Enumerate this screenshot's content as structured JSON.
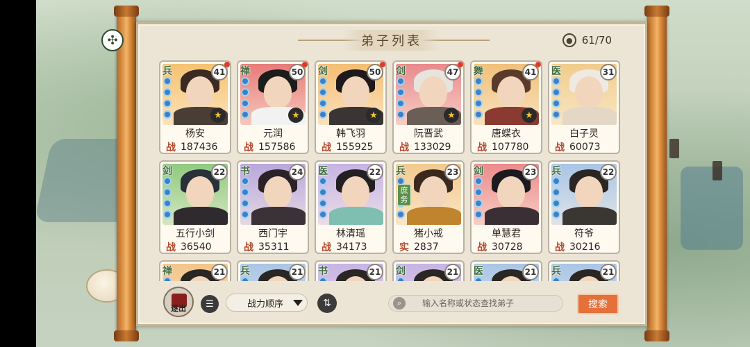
{
  "header": {
    "title": "弟子列表",
    "count_label": "61/70"
  },
  "role_icons": {
    "pin": "pin-icon",
    "person": "person-icon"
  },
  "disciples": [
    {
      "role": "兵",
      "level": "41",
      "name": "杨安",
      "power_label": "战",
      "power": "187436",
      "bg": "#f6c272",
      "hair": "#3a2a22",
      "body": "#4a3d36",
      "red_dot": true,
      "star": true
    },
    {
      "role": "禅",
      "level": "50",
      "name": "元润",
      "power_label": "战",
      "power": "157586",
      "bg": "#e77b78",
      "hair": "#1c1c1c",
      "body": "#f2f2f2",
      "red_dot": true,
      "star": true
    },
    {
      "role": "剑",
      "level": "50",
      "name": "韩飞羽",
      "power_label": "战",
      "power": "155925",
      "bg": "#f4be74",
      "hair": "#1e1a1a",
      "body": "#3a3434",
      "red_dot": true,
      "star": true
    },
    {
      "role": "剑",
      "level": "47",
      "name": "阮晋武",
      "power_label": "战",
      "power": "133029",
      "bg": "#e98a8d",
      "hair": "#e7e3dd",
      "body": "#6a5e57",
      "red_dot": true,
      "star": true
    },
    {
      "role": "舞",
      "level": "41",
      "name": "唐蝶衣",
      "power_label": "战",
      "power": "107780",
      "bg": "#f0c07a",
      "hair": "#5a3a2a",
      "body": "#8a3a30",
      "red_dot": true,
      "star": true
    },
    {
      "role": "医",
      "level": "31",
      "name": "白子灵",
      "power_label": "战",
      "power": "60073",
      "bg": "#f0cc8c",
      "hair": "#efe9e2",
      "body": "#e4d7c6",
      "red_dot": false,
      "star": false
    },
    {
      "role": "剑",
      "level": "22",
      "name": "五行小剑",
      "power_label": "战",
      "power": "36540",
      "bg": "#8fca7f",
      "hair": "#28303a",
      "body": "#2e2a2e",
      "red_dot": false,
      "star": false
    },
    {
      "role": "书",
      "level": "24",
      "name": "西门宇",
      "power_label": "战",
      "power": "35311",
      "bg": "#b9a6dc",
      "hair": "#2a2228",
      "body": "#3a3236",
      "red_dot": false,
      "star": false
    },
    {
      "role": "医",
      "level": "22",
      "name": "林清瑶",
      "power_label": "战",
      "power": "34173",
      "bg": "#c7b3e5",
      "hair": "#232024",
      "body": "#7fbfb1",
      "red_dot": false,
      "star": false
    },
    {
      "role": "兵",
      "level": "23",
      "name": "猪小戒",
      "power_label": "实",
      "power": "2837",
      "bg": "#f2c98f",
      "hair": "#3a2a1e",
      "body": "#c0832e",
      "red_dot": false,
      "star": false,
      "tag": "庶务"
    },
    {
      "role": "剑",
      "level": "23",
      "name": "单慧君",
      "power_label": "战",
      "power": "30728",
      "bg": "#ec8a8c",
      "hair": "#1b1b1f",
      "body": "#3a2f35",
      "red_dot": false,
      "star": false
    },
    {
      "role": "兵",
      "level": "22",
      "name": "符爷",
      "power_label": "战",
      "power": "30216",
      "bg": "#a9c5e6",
      "hair": "#2a2624",
      "body": "#3a3632",
      "red_dot": false,
      "star": false
    },
    {
      "role": "禅",
      "level": "21",
      "name": "",
      "power_label": "",
      "power": "",
      "bg": "#f2c48a",
      "hair": "#2a2624",
      "body": "#3a3632",
      "red_dot": false,
      "star": false
    },
    {
      "role": "兵",
      "level": "21",
      "name": "",
      "power_label": "",
      "power": "",
      "bg": "#a9c5e6",
      "hair": "#2a2624",
      "body": "#3a3632",
      "red_dot": false,
      "star": false
    },
    {
      "role": "书",
      "level": "21",
      "name": "",
      "power_label": "",
      "power": "",
      "bg": "#c7b3e5",
      "hair": "#2a2624",
      "body": "#3a3632",
      "red_dot": false,
      "star": false
    },
    {
      "role": "剑",
      "level": "21",
      "name": "",
      "power_label": "",
      "power": "",
      "bg": "#c7b3e5",
      "hair": "#2a2624",
      "body": "#3a3632",
      "red_dot": false,
      "star": false
    },
    {
      "role": "医",
      "level": "21",
      "name": "",
      "power_label": "",
      "power": "",
      "bg": "#a9c5e6",
      "hair": "#2a2624",
      "body": "#3a3632",
      "red_dot": false,
      "star": false
    },
    {
      "role": "兵",
      "level": "21",
      "name": "",
      "power_label": "",
      "power": "",
      "bg": "#a9c5e6",
      "hair": "#2a2624",
      "body": "#3a3632",
      "red_dot": false,
      "star": false
    }
  ],
  "toolbar": {
    "exit_label": "逐出",
    "sort_label": "战力顺序",
    "search_placeholder": "输入名称或状态查找弟子",
    "search_button": "搜索"
  }
}
